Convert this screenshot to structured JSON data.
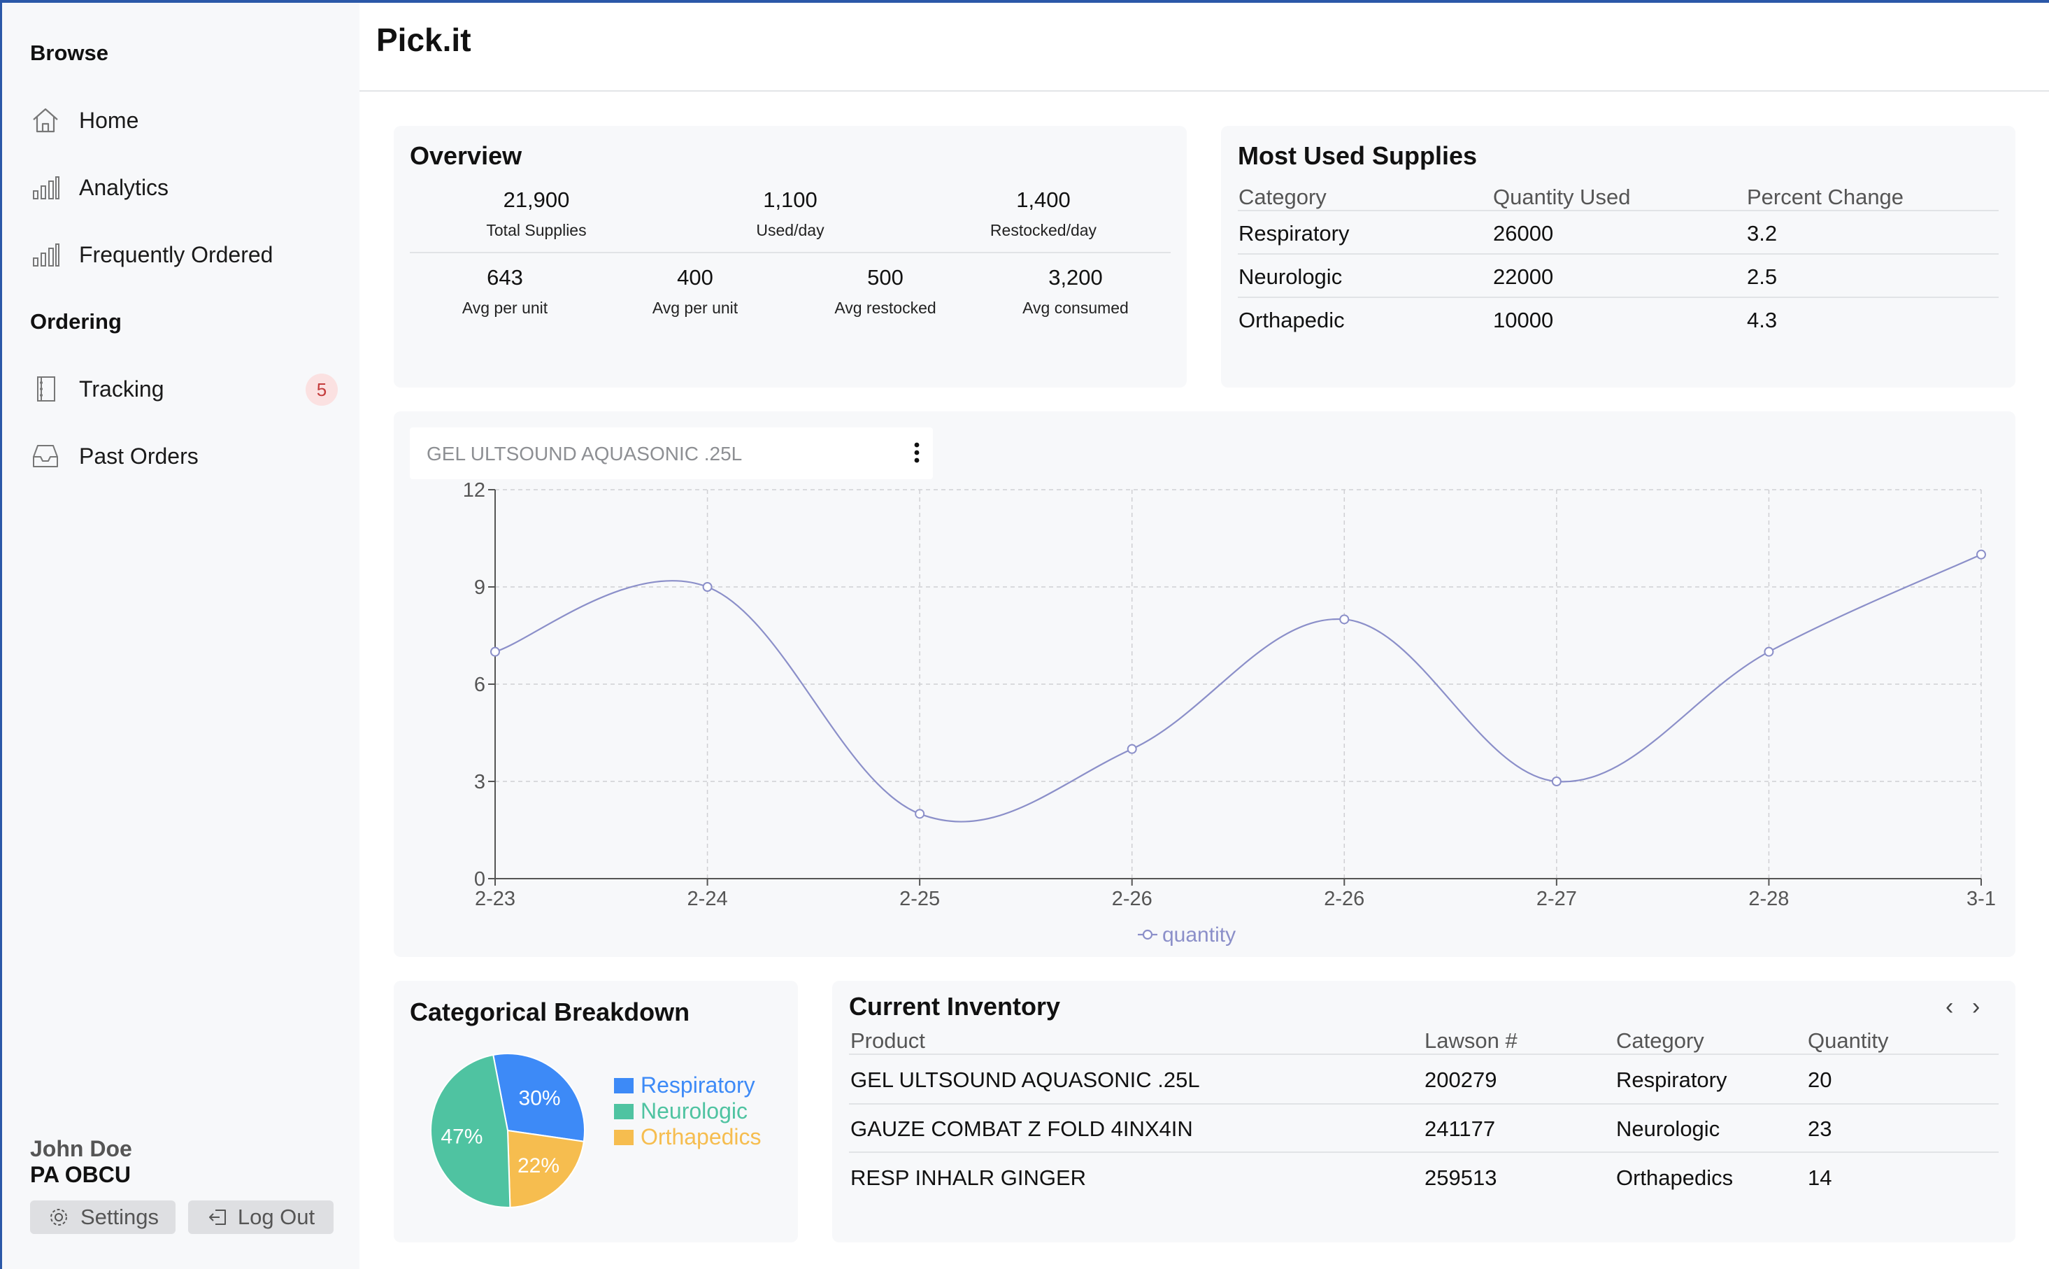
{
  "app": {
    "title": "Pick.it"
  },
  "sidebar": {
    "browse_heading": "Browse",
    "ordering_heading": "Ordering",
    "browse_items": [
      {
        "label": "Home",
        "icon": "home-icon"
      },
      {
        "label": "Analytics",
        "icon": "bar-chart-icon"
      },
      {
        "label": "Frequently Ordered",
        "icon": "bar-chart-icon"
      }
    ],
    "ordering_items": [
      {
        "label": "Tracking",
        "icon": "notebook-icon",
        "badge": "5"
      },
      {
        "label": "Past Orders",
        "icon": "inbox-icon"
      }
    ],
    "user": {
      "name": "John Doe",
      "role": "PA OBCU"
    },
    "settings_label": "Settings",
    "logout_label": "Log Out"
  },
  "overview": {
    "title": "Overview",
    "top_stats": [
      {
        "value": "21,900",
        "label": "Total Supplies"
      },
      {
        "value": "1,100",
        "label": "Used/day"
      },
      {
        "value": "1,400",
        "label": "Restocked/day"
      }
    ],
    "bottom_stats": [
      {
        "value": "643",
        "label": "Avg per unit"
      },
      {
        "value": "400",
        "label": "Avg per unit"
      },
      {
        "value": "500",
        "label": "Avg restocked"
      },
      {
        "value": "3,200",
        "label": "Avg consumed"
      }
    ]
  },
  "most_used": {
    "title": "Most Used Supplies",
    "columns": [
      "Category",
      "Quantity Used",
      "Percent Change"
    ],
    "rows": [
      [
        "Respiratory",
        "26000",
        "3.2"
      ],
      [
        "Neurologic",
        "22000",
        "2.5"
      ],
      [
        "Orthapedic",
        "10000",
        "4.3"
      ]
    ]
  },
  "line_chart": {
    "selected_product": "GEL ULTSOUND AQUASONIC .25L",
    "legend": "quantity"
  },
  "breakdown": {
    "title": "Categorical Breakdown",
    "legend": [
      {
        "label": "Respiratory",
        "color": "#3d8af7"
      },
      {
        "label": "Neurologic",
        "color": "#4fc3a1"
      },
      {
        "label": "Orthapedics",
        "color": "#f6bd4f"
      }
    ]
  },
  "inventory": {
    "title": "Current Inventory",
    "columns": [
      "Product",
      "Lawson #",
      "Category",
      "Quantity"
    ],
    "rows": [
      [
        "GEL ULTSOUND AQUASONIC .25L",
        "200279",
        "Respiratory",
        "20"
      ],
      [
        "GAUZE COMBAT Z FOLD 4INX4IN",
        "241177",
        "Neurologic",
        "23"
      ],
      [
        "RESP INHALR GINGER",
        "259513",
        "Orthapedics",
        "14"
      ]
    ],
    "prev_label": "‹",
    "next_label": "›"
  },
  "chart_data": [
    {
      "type": "line",
      "x": [
        "2-23",
        "2-24",
        "2-25",
        "2-26",
        "2-26",
        "2-27",
        "2-28",
        "3-1"
      ],
      "series": [
        {
          "name": "quantity",
          "values": [
            7,
            9,
            2,
            4,
            8,
            3,
            7,
            10
          ],
          "color": "#8b8fc9"
        }
      ],
      "ylim": [
        0,
        12
      ],
      "yticks": [
        0,
        3,
        6,
        9,
        12
      ],
      "grid": true,
      "legend_position": "bottom",
      "smooth": true
    },
    {
      "type": "pie",
      "categories": [
        "Respiratory",
        "Neurologic",
        "Orthapedics"
      ],
      "values": [
        30,
        47,
        22
      ],
      "labels": [
        "30%",
        "47%",
        "22%"
      ],
      "colors": [
        "#3d8af7",
        "#4fc3a1",
        "#f6bd4f"
      ],
      "legend_position": "right"
    }
  ]
}
